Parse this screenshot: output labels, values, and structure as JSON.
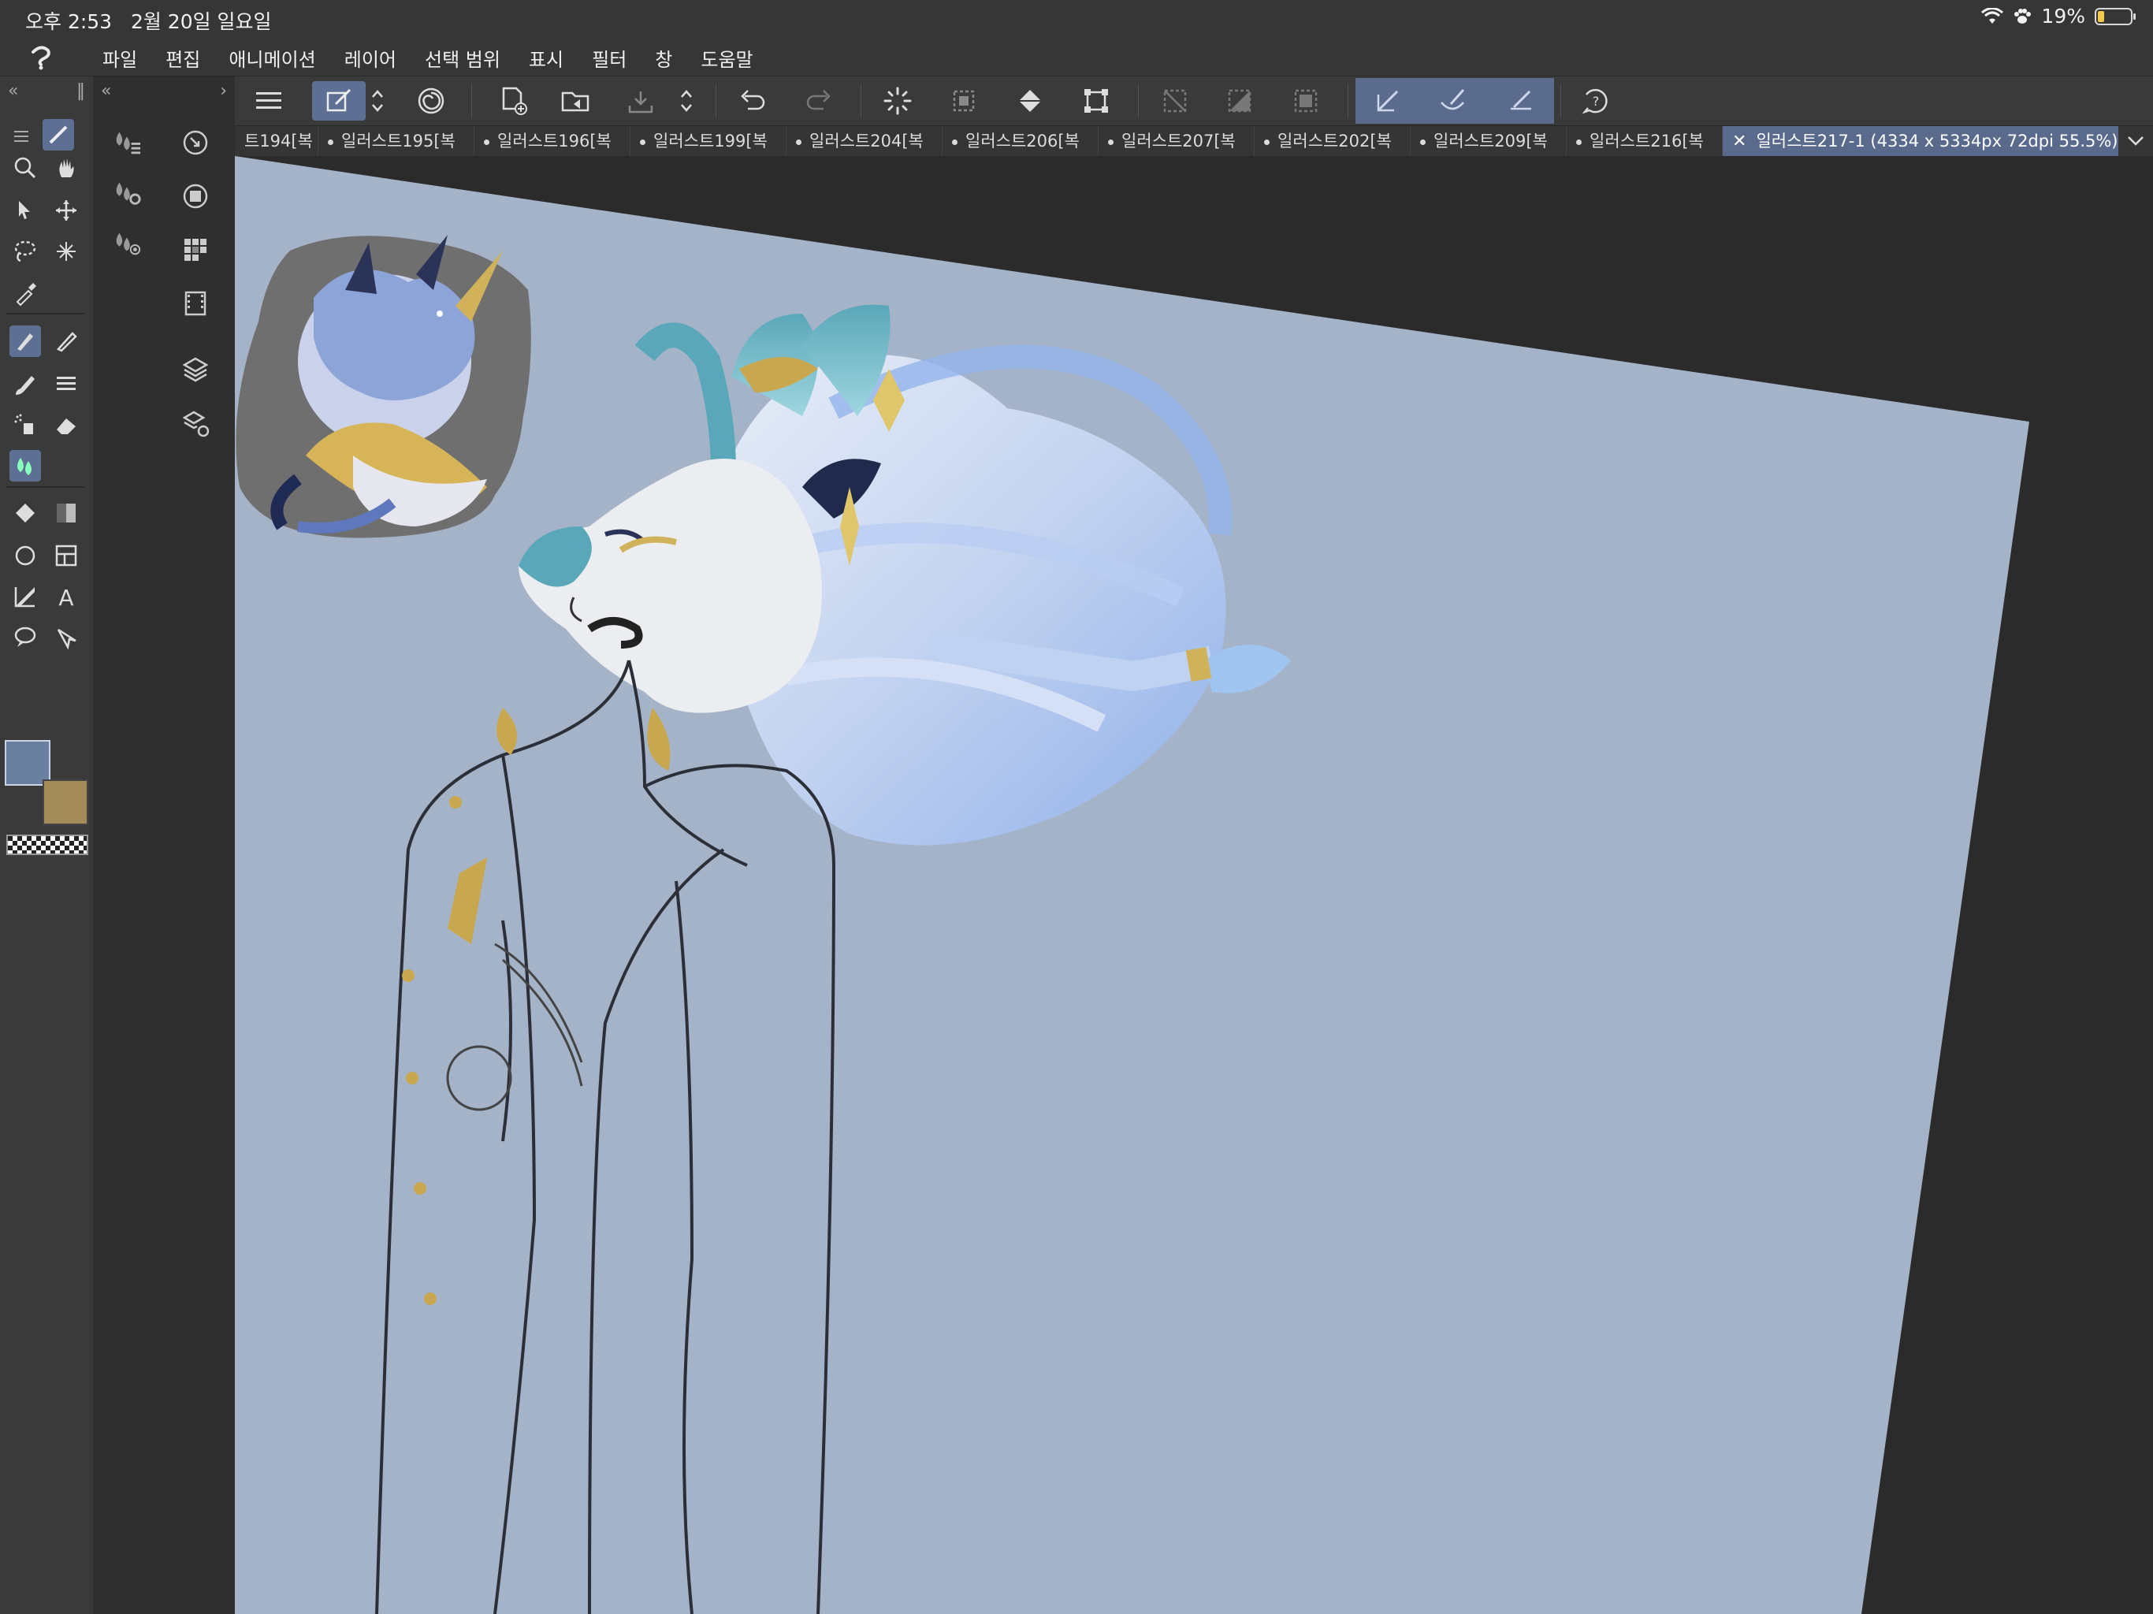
{
  "status_bar": {
    "time": "오후 2:53",
    "date": "2월 20일 일요일",
    "battery": "19%",
    "battery_level": 0.19
  },
  "menu_bar": {
    "items": [
      "파일",
      "편집",
      "애니메이션",
      "레이어",
      "선택 범위",
      "표시",
      "필터",
      "창",
      "도움말"
    ]
  },
  "tabs": {
    "items": [
      "트194[복",
      "일러스트195[복",
      "일러스트196[복",
      "일러스트199[복",
      "일러스트204[복",
      "일러스트206[복",
      "일러스트207[복",
      "일러스트202[복",
      "일러스트209[복",
      "일러스트216[복"
    ],
    "active": "일러스트217-1 (4334 x 5334px 72dpi 55.5%)"
  },
  "colors": {
    "main_color": "#6b7f9e",
    "sub_color": "#a38c5a",
    "accent": "#5a6b8e",
    "canvas_bg": "#a5b3c9"
  },
  "tools": [
    "zoom-icon",
    "hand-icon",
    "operation-icon",
    "move-layer-icon",
    "lasso-select-icon",
    "magic-wand-icon",
    "eyedropper-icon",
    "pen-icon",
    "pencil-icon",
    "brush-icon",
    "decoration-icon",
    "airbrush-icon",
    "eraser-icon",
    "blend-icon",
    "fill-icon",
    "gradient-icon",
    "figure-icon",
    "frame-icon",
    "ruler-icon",
    "text-icon",
    "balloon-icon",
    "correct-line-icon"
  ]
}
